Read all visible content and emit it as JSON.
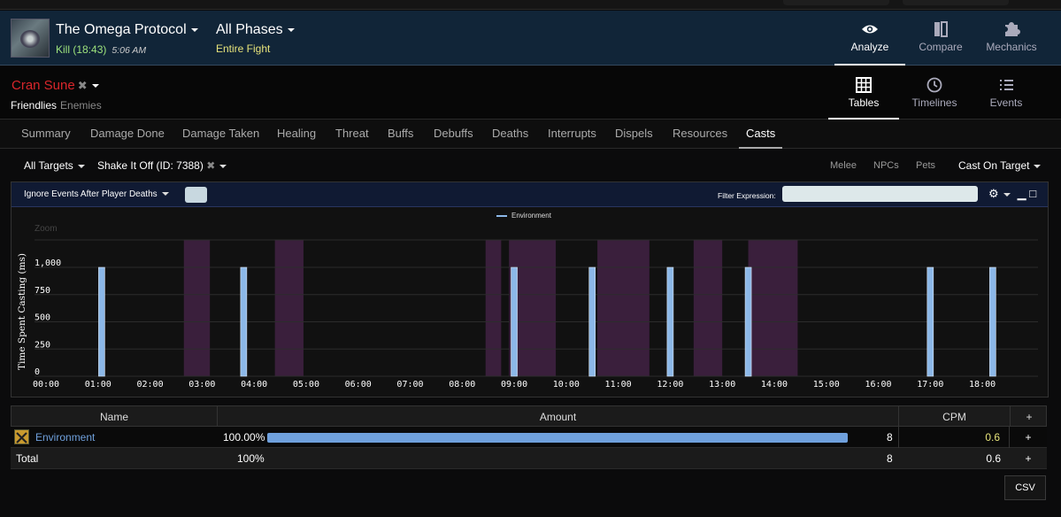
{
  "header": {
    "encounter_title": "The Omega Protocol",
    "kill_label": "Kill (18:43)",
    "kill_time": "5:06 AM",
    "phase_title": "All Phases",
    "phase_sub": "Entire Fight",
    "nav": [
      {
        "label": "Analyze",
        "icon": "eye-icon",
        "active": true
      },
      {
        "label": "Compare",
        "icon": "compare-icon",
        "active": false
      },
      {
        "label": "Mechanics",
        "icon": "puzzle-icon",
        "active": false
      }
    ]
  },
  "subheader": {
    "player_name": "Cran Sune",
    "player_x": "✖",
    "friendlies": "Friendlies",
    "enemies": "Enemies",
    "views": [
      {
        "label": "Tables",
        "icon": "table-icon",
        "active": true
      },
      {
        "label": "Timelines",
        "icon": "clock-icon",
        "active": false
      },
      {
        "label": "Events",
        "icon": "list-icon",
        "active": false
      }
    ]
  },
  "tabs": [
    "Summary",
    "Damage Done",
    "Damage Taken",
    "Healing",
    "Threat",
    "Buffs",
    "Debuffs",
    "Deaths",
    "Interrupts",
    "Dispels",
    "Resources",
    "Casts"
  ],
  "active_tab": "Casts",
  "filters": {
    "targets": "All Targets",
    "ability": "Shake It Off (ID: 7388)",
    "ability_x": "✖",
    "melee": "Melee",
    "npcs": "NPCs",
    "pets": "Pets",
    "cast_on_target": "Cast On Target"
  },
  "chart_toolbar": {
    "ignore_label": "Ignore Events After Player Deaths",
    "filter_label": "Filter Expression:",
    "filter_value": "",
    "gear": "⚙",
    "minimize": "▁",
    "maximize": "□"
  },
  "chart_data": {
    "type": "bar",
    "ylabel": "Time Spent Casting (ms)",
    "zoom_label": "Zoom",
    "x_ticks": [
      "00:00",
      "01:00",
      "02:00",
      "03:00",
      "04:00",
      "05:00",
      "06:00",
      "07:00",
      "08:00",
      "09:00",
      "10:00",
      "11:00",
      "12:00",
      "13:00",
      "14:00",
      "15:00",
      "16:00",
      "17:00",
      "18:00"
    ],
    "y_ticks": [
      "1,000",
      "750",
      "500",
      "250",
      "0"
    ],
    "ylim": [
      0,
      1000
    ],
    "x_range_minutes": [
      0,
      18.9
    ],
    "series": [
      {
        "name": "Environment",
        "color": "#8cb8e8",
        "x_minutes": [
          1.07,
          3.8,
          9.0,
          10.5,
          12.0,
          13.5,
          17.0,
          18.2
        ],
        "values": [
          1000,
          1000,
          1000,
          1000,
          1000,
          1000,
          1000,
          1000
        ]
      }
    ],
    "highlight_color": "#3a1f3c",
    "highlights": [
      [
        2.65,
        3.15
      ],
      [
        4.4,
        4.95
      ],
      [
        8.45,
        8.75
      ],
      [
        8.9,
        9.8
      ],
      [
        10.6,
        11.6
      ],
      [
        12.45,
        13.0
      ],
      [
        13.5,
        14.45
      ]
    ]
  },
  "table": {
    "headers": {
      "name": "Name",
      "amount": "Amount",
      "cpm": "CPM",
      "plus": "+"
    },
    "rows": [
      {
        "name": "Environment",
        "pct": "100.00%",
        "fill": 1.0,
        "count": "8",
        "cpm": "0.6",
        "plus": "+"
      }
    ],
    "total": {
      "name": "Total",
      "pct": "100%",
      "count": "8",
      "cpm": "0.6",
      "plus": "+"
    }
  },
  "csv_label": "CSV"
}
